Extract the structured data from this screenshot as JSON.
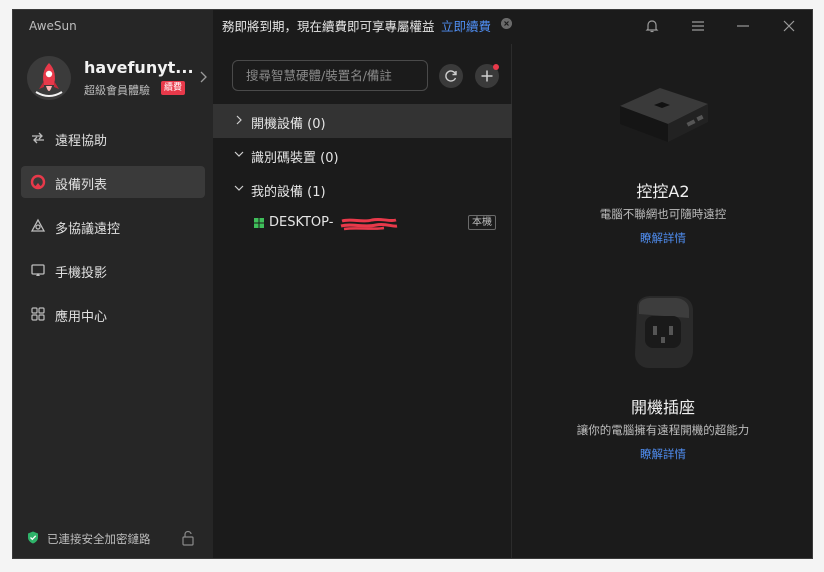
{
  "app": {
    "name": "AweSun"
  },
  "banner": {
    "text": "務即將到期，現在續費即可享專屬權益",
    "link": "立即續費"
  },
  "user": {
    "name": "havefunyt...",
    "membership": "超級會員體驗",
    "badge": "續費"
  },
  "nav": {
    "items": [
      {
        "label": "遠程協助",
        "icon": "swap-arrows-icon",
        "active": false
      },
      {
        "label": "設備列表",
        "icon": "device-list-icon",
        "active": true
      },
      {
        "label": "多協議遠控",
        "icon": "multi-protocol-icon",
        "active": false
      },
      {
        "label": "手機投影",
        "icon": "screen-cast-icon",
        "active": false
      },
      {
        "label": "應用中心",
        "icon": "app-grid-icon",
        "active": false
      }
    ]
  },
  "status": {
    "secure_text": "已連接安全加密鏈路"
  },
  "devices": {
    "search_placeholder": "搜尋智慧硬體/裝置名/備註",
    "groups": [
      {
        "label": "開機設備 (0)",
        "expanded": false
      },
      {
        "label": "識別碼裝置 (0)",
        "expanded": true
      },
      {
        "label": "我的設備 (1)",
        "expanded": true
      }
    ],
    "items": [
      {
        "name": "DESKTOP-",
        "tag": "本機"
      }
    ]
  },
  "promo": [
    {
      "title": "控控A2",
      "desc": "電腦不聯網也可隨時遠控",
      "link": "瞭解詳情"
    },
    {
      "title": "開機插座",
      "desc": "讓你的電腦擁有遠程開機的超能力",
      "link": "瞭解詳情"
    }
  ],
  "colors": {
    "accent": "#4f8df0",
    "brand_red": "#e8394a",
    "sidebar_bg": "#262626",
    "main_bg": "#1b1b1b"
  }
}
